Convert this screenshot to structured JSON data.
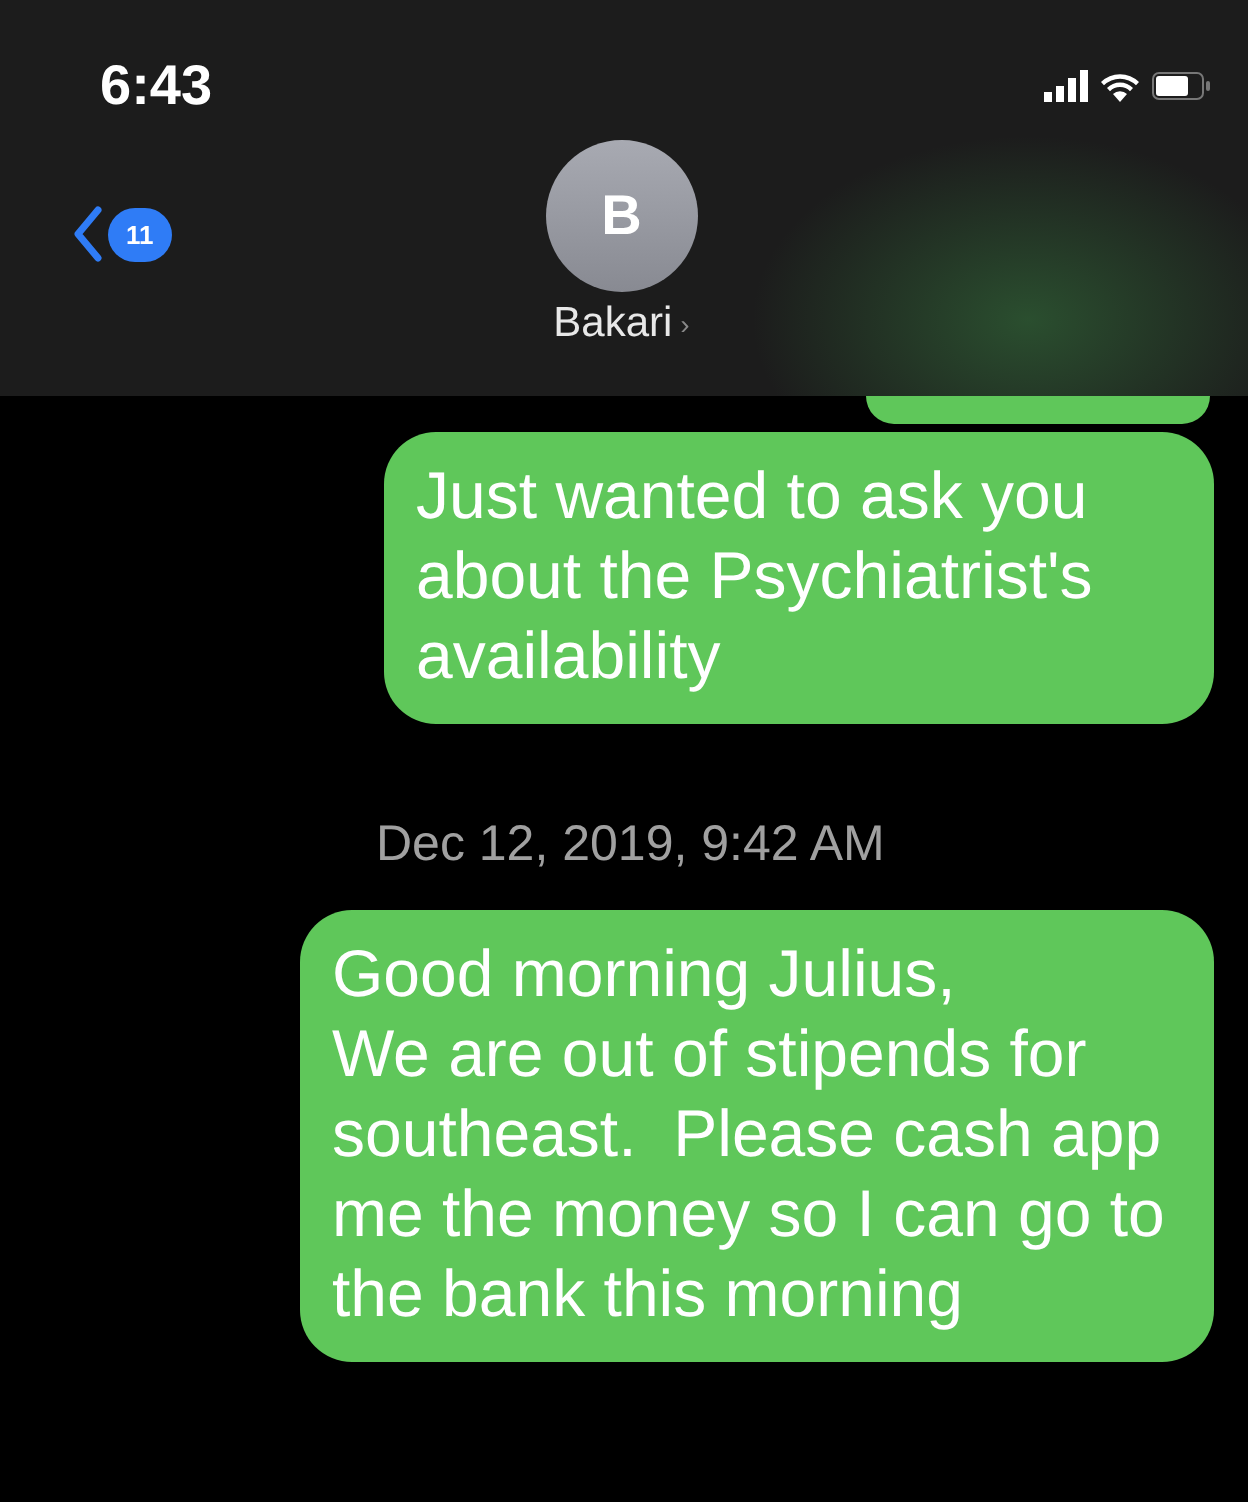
{
  "status_bar": {
    "time": "6:43"
  },
  "nav": {
    "back_badge": "11",
    "avatar_initial": "B",
    "contact_name": "Bakari",
    "name_chevron": "›"
  },
  "messages": [
    {
      "kind": "bubble",
      "text": "Just wanted to ask you about the Psychiatrist's availability"
    },
    {
      "kind": "timestamp",
      "text": "Dec 12, 2019, 9:42 AM"
    },
    {
      "kind": "bubble",
      "text": "Good morning Julius,\nWe are out of stipends for southeast.  Please cash app me the money so I can go to the bank this morning"
    }
  ]
}
